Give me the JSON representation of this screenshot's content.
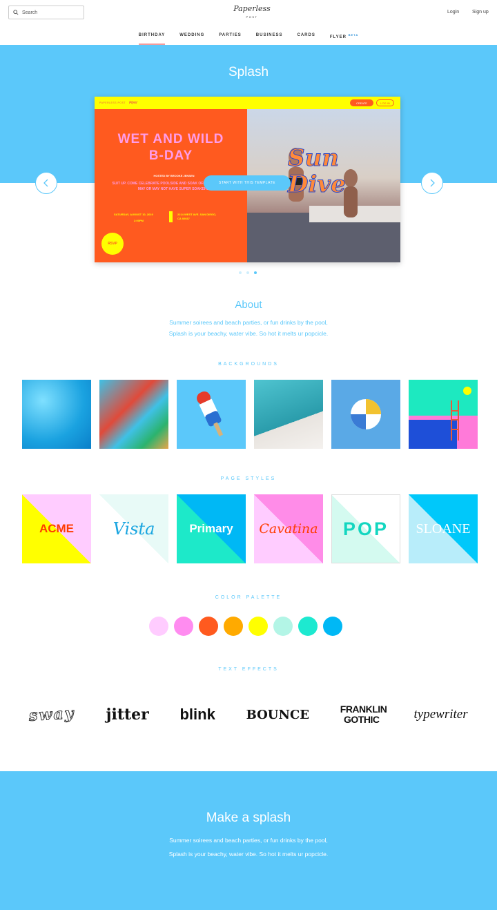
{
  "header": {
    "search_placeholder": "Search",
    "logo": "Paperless",
    "logo_sub": "POST",
    "login": "Login",
    "signup": "Sign up",
    "nav": [
      {
        "label": "BIRTHDAY",
        "active": true
      },
      {
        "label": "WEDDING"
      },
      {
        "label": "PARTIES"
      },
      {
        "label": "BUSINESS"
      },
      {
        "label": "CARDS"
      },
      {
        "label": "FLYER",
        "badge": "BETA"
      }
    ]
  },
  "hero": {
    "title": "Splash",
    "card": {
      "brand": "PAPERLESS POST",
      "flyer_label": "Flyer",
      "create_button": "CREATE",
      "login_button": "LOG IN",
      "headline": "WET AND WILD B-DAY",
      "hosted_by": "HOSTED BY BROOKE JENSEN",
      "body": "SUIT UP. COME CELEBRATE POOLSIDE AND SOAK OFF THOSE TANS. WE MAY OR MAY NOT HAVE SUPER SOAKERS.",
      "date": "SATURDAY, AUGUST 10, 2019",
      "time": "2:00PM",
      "address": "2214 WEST AVE. SAN DIEGO, CA 92037",
      "rsvp": "RSVP",
      "overlay_text": "Sun Dive",
      "cta": "START WITH THIS TEMPLATE"
    },
    "slides": 3,
    "active_slide": 3
  },
  "about": {
    "title": "About",
    "line1": "Summer soirees and beach parties, or fun drinks by the pool,",
    "line2": "Splash is your beachy, water vibe. So hot it melts ur popcicle."
  },
  "backgrounds": {
    "label": "BACKGROUNDS",
    "items": [
      "pool-water",
      "pool-party",
      "popsicle",
      "diving-board",
      "beach-ball",
      "pool-ladder"
    ]
  },
  "page_styles": {
    "label": "PAGE STYLES",
    "items": [
      {
        "name": "ACME",
        "c1": "#ffff00",
        "c2": "#ffccff",
        "text": "#ff3c00"
      },
      {
        "name": "Vista",
        "c1": "#ffffff",
        "c2": "#e8faf7",
        "text": "#1aa5e0"
      },
      {
        "name": "Primary",
        "c1": "#1de9c9",
        "c2": "#00b8f5",
        "text": "#ffffff"
      },
      {
        "name": "Cavatina",
        "c1": "#ffccff",
        "c2": "#ff8ce8",
        "text": "#ff3c00"
      },
      {
        "name": "POP",
        "c1": "#d4faf0",
        "c2": "#ffffff",
        "text": "#14d6c0"
      },
      {
        "name": "SLOANE",
        "c1": "#b8edfa",
        "c2": "#00c8fa",
        "text": "#ffffff"
      }
    ]
  },
  "color_palette": {
    "label": "COLOR PALETTE",
    "colors": [
      "#ffccff",
      "#ff8cf0",
      "#ff5a1f",
      "#ffaa00",
      "#ffff00",
      "#b3f5e6",
      "#1de9d0",
      "#00b8f5"
    ]
  },
  "text_effects": {
    "label": "TEXT EFFECTS",
    "items": [
      "sway",
      "jitter",
      "blink",
      "BOUNCE",
      "FRANKLIN GOTHIC",
      "typewriter"
    ]
  },
  "footer": {
    "title": "Make a splash",
    "line1": "Summer soirees and beach parties, or fun drinks by the pool,",
    "line2": "Splash is your beachy, water vibe. So hot it melts ur popcicle."
  }
}
